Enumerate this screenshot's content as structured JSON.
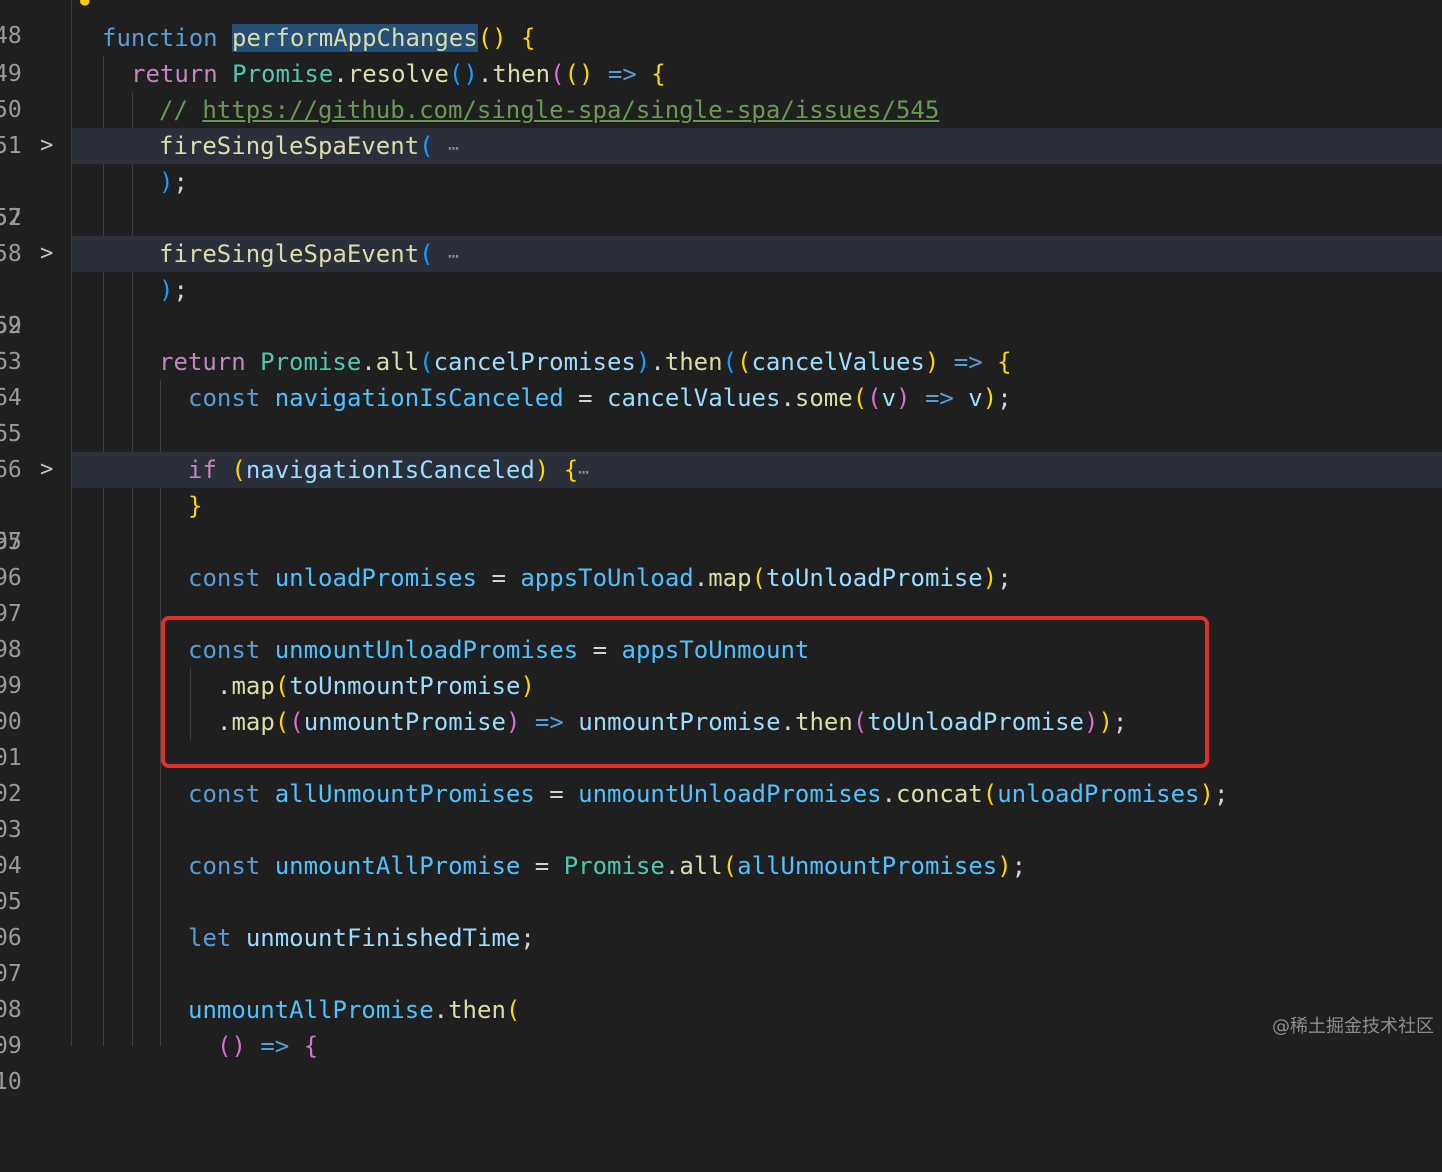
{
  "colors": {
    "background": "#1f1f1f",
    "fold_highlight": "#2a2f3a",
    "annotation_box": "#e0302a"
  },
  "icons": {
    "lightbulb": "lightbulb-icon",
    "fold": "chevron-right-icon"
  },
  "editor": {
    "line_numbers": [
      "48",
      "49",
      "50",
      "51",
      "52",
      "57",
      "58",
      "59",
      "62",
      "63",
      "64",
      "65",
      "66",
      "67",
      "95",
      "96",
      "97",
      "98",
      "99",
      "00",
      "01",
      "02",
      "03",
      "04",
      "05",
      "06",
      "07",
      "08",
      "09",
      "10"
    ],
    "fold_ellipsis": "⋯",
    "lines": {
      "l49": {
        "k": "function",
        "name": "performAppChanges",
        "p1": "()",
        "sp": " ",
        "b": "{"
      },
      "l50": {
        "ret": "return",
        "cls": "Promise",
        "dot": ".",
        "fn": "resolve",
        "p1": "()",
        "dot2": ".",
        "fn2": "then",
        "b1": "(",
        "p2": "()",
        "arrow": " => ",
        "b2": "{"
      },
      "l51": {
        "cmt": "// ",
        "url": "https://github.com/single-spa/single-spa/issues/545"
      },
      "l52": {
        "fn": "fireSingleSpaEvent",
        "b": "("
      },
      "l57": {
        "b": ")",
        "semi": ";"
      },
      "l59": {
        "fn": "fireSingleSpaEvent",
        "b": "("
      },
      "l62": {
        "b": ")",
        "semi": ";"
      },
      "l64": {
        "ret": "return",
        "cls": "Promise",
        "dot": ".",
        "fn": "all",
        "b1": "(",
        "arg": "cancelPromises",
        "b1c": ")",
        "dot2": ".",
        "fn2": "then",
        "b2": "(",
        "b3": "(",
        "arg2": "cancelValues",
        "b3c": ")",
        "arrow": " => ",
        "b4": "{"
      },
      "l65": {
        "k": "const",
        "name": "navigationIsCanceled",
        "eq": " = ",
        "obj": "cancelValues",
        "dot": ".",
        "fn": "some",
        "b1": "(",
        "b2": "(",
        "arg": "v",
        "b2c": ")",
        "arrow": " => ",
        "ret": "v",
        "b1c": ")",
        "semi": ";"
      },
      "l67": {
        "k": "if",
        "b1": "(",
        "arg": "navigationIsCanceled",
        "b1c": ")",
        "b2": "{"
      },
      "l95": {
        "b": "}"
      },
      "l97": {
        "k": "const",
        "name": "unloadPromises",
        "eq": " = ",
        "obj": "appsToUnload",
        "dot": ".",
        "fn": "map",
        "b1": "(",
        "arg": "toUnloadPromise",
        "b1c": ")",
        "semi": ";"
      },
      "l99": {
        "k": "const",
        "name": "unmountUnloadPromises",
        "eq": " = ",
        "obj": "appsToUnmount"
      },
      "l100": {
        "dot": ".",
        "fn": "map",
        "b1": "(",
        "arg": "toUnmountPromise",
        "b1c": ")"
      },
      "l101": {
        "dot": ".",
        "fn": "map",
        "b1": "(",
        "b2": "(",
        "arg": "unmountPromise",
        "b2c": ")",
        "arrow": " => ",
        "obj": "unmountPromise",
        "dot2": ".",
        "fn2": "then",
        "b3": "(",
        "arg2": "toUnloadPromise",
        "b3c": ")",
        "b1c": ")",
        "semi": ";"
      },
      "l103": {
        "k": "const",
        "name": "allUnmountPromises",
        "eq": " = ",
        "obj": "unmountUnloadPromises",
        "dot": ".",
        "fn": "concat",
        "b1": "(",
        "arg": "unloadPromises",
        "b1c": ")",
        "semi": ";"
      },
      "l105": {
        "k": "const",
        "name": "unmountAllPromise",
        "eq": " = ",
        "cls": "Promise",
        "dot": ".",
        "fn": "all",
        "b1": "(",
        "arg": "allUnmountPromises",
        "b1c": ")",
        "semi": ";"
      },
      "l107": {
        "k": "let",
        "name": "unmountFinishedTime",
        "semi": ";"
      },
      "l109": {
        "obj": "unmountAllPromise",
        "dot": ".",
        "fn": "then",
        "b1": "("
      },
      "l110": {
        "b1": "()",
        "arrow": " => ",
        "b2": "{"
      }
    }
  },
  "watermark": "@稀土掘金技术社区"
}
